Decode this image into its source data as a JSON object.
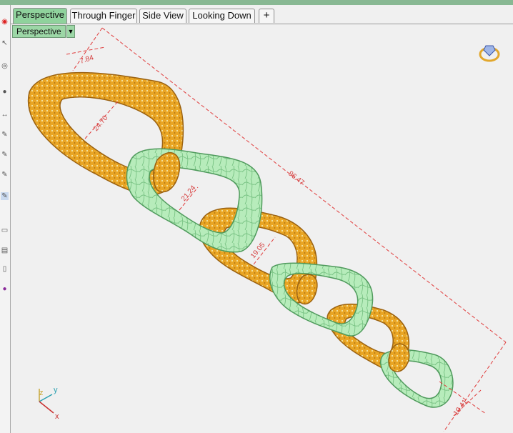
{
  "tabs": [
    {
      "label": "Perspective",
      "active": true
    },
    {
      "label": "Through Finger",
      "active": false
    },
    {
      "label": "Side View",
      "active": false
    },
    {
      "label": "Looking Down",
      "active": false
    }
  ],
  "add_tab_symbol": "+",
  "viewport": {
    "name": "Perspective",
    "dropdown_glyph": "▼"
  },
  "dimensions": [
    "7.84",
    "24.70",
    "96.47",
    "21.24",
    "19.05",
    "10.41"
  ],
  "axes": {
    "x": "x",
    "y": "y",
    "z": "z"
  },
  "colors": {
    "gold": "#e9a524",
    "green": "#b7ecbb",
    "dimension_line": "#e03c3c",
    "active_tab": "#8fd29c"
  },
  "icons": [
    "nav-cube-ring-icon"
  ]
}
